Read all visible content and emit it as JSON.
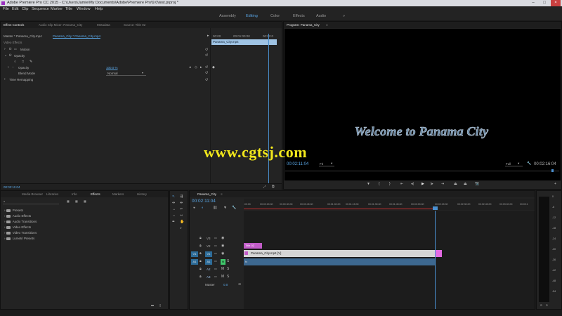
{
  "titlebar": {
    "title": "Adobe Premiere Pro CC 2015 - C:\\Users\\Jamie\\My Documents\\Adobe\\Premiere Pro\\9.0\\test.prproj *"
  },
  "menu": [
    "File",
    "Edit",
    "Clip",
    "Sequence",
    "Marker",
    "Title",
    "Window",
    "Help"
  ],
  "workspaces": {
    "items": [
      "Assembly",
      "Editing",
      "Color",
      "Effects",
      "Audio"
    ],
    "more": "»"
  },
  "effect_controls": {
    "tabs": [
      "Effect Controls",
      "Audio Clip Mixer: Panama_City",
      "Metadata",
      "Source: Title 02"
    ],
    "master": "Master * Panama_City.mp4",
    "sequence_clip": "Panama_City * Panama_City.mp4",
    "section": "Video Effects",
    "motion": "Motion",
    "opacity": "Opacity",
    "opacity_sub": "Opacity",
    "opacity_value": "100.0 %",
    "blend_mode": "Blend Mode",
    "blend_value": "Normal",
    "time_remap": "Time Remapping",
    "ruler": [
      "00:00",
      "00:01:00:00",
      "00:02:0"
    ],
    "clip_bar": "Panama_City.mp4",
    "timecode": "00:02:11:04"
  },
  "program": {
    "tab": "Program: Panama_City",
    "overlay_title": "Welcome to Panama City",
    "timecode": "00:02:11:04",
    "fit": "Fit",
    "quality": "Full",
    "duration": "00:02:16:04"
  },
  "watermark": "www.cgtsj.com",
  "effects_panel": {
    "tabs": [
      "Media Browser",
      "Libraries",
      "Info",
      "Effects",
      "Markers",
      "History"
    ],
    "folders": [
      "Presets",
      "Audio Effects",
      "Audio Transitions",
      "Video Effects",
      "Video Transitions",
      "Lumetri Presets"
    ]
  },
  "timeline": {
    "tab": "Panama_City",
    "timecode": "00:02:11:04",
    "ruler": [
      ":00:00",
      "00:00:15:00",
      "00:00:30:00",
      "00:00:45:00",
      "00:01:00:00",
      "00:01:15:00",
      "00:01:30:00",
      "00:01:45:00",
      "00:02:00:00",
      "00:02:15:00",
      "00:02:30:00",
      "00:02:45:00",
      "00:03:00:00",
      "00:03:1"
    ],
    "tracks": [
      {
        "src": "",
        "name": "V3"
      },
      {
        "src": "",
        "name": "V2"
      },
      {
        "src": "V1",
        "name": "V1"
      },
      {
        "src": "A1",
        "name": "A1"
      },
      {
        "src": "",
        "name": "A2"
      },
      {
        "src": "",
        "name": "A3"
      }
    ],
    "master": "Master",
    "master_val": "0.0",
    "clip_title": "Title 02",
    "clip_video": "Panama_City.mp4 [V]",
    "clip_audio_fx": "fx"
  },
  "meters": {
    "labels": [
      "0",
      "-6",
      "-12",
      "-18",
      "-24",
      "-30",
      "-36",
      "-42",
      "-48",
      "-54"
    ],
    "footer": [
      "S",
      "S"
    ]
  }
}
